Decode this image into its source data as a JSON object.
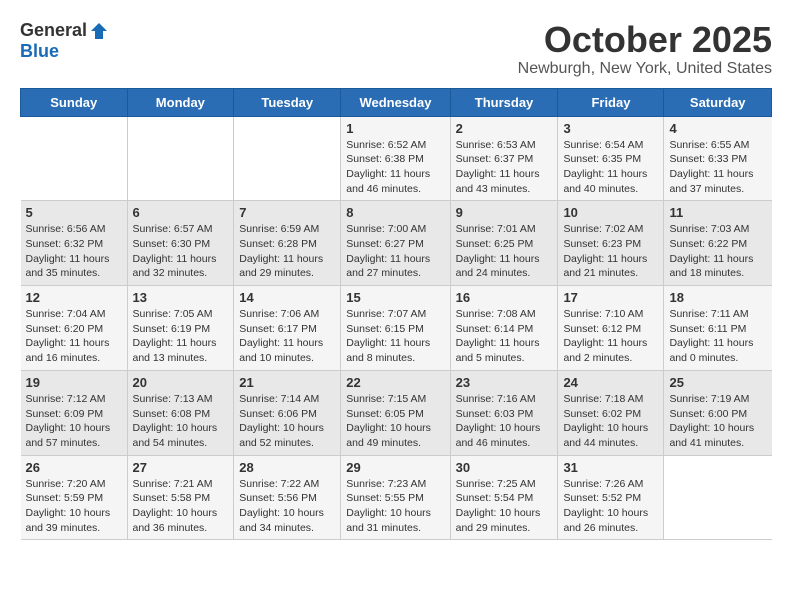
{
  "header": {
    "logo_general": "General",
    "logo_blue": "Blue",
    "month_title": "October 2025",
    "location": "Newburgh, New York, United States"
  },
  "days_of_week": [
    "Sunday",
    "Monday",
    "Tuesday",
    "Wednesday",
    "Thursday",
    "Friday",
    "Saturday"
  ],
  "weeks": [
    [
      {
        "day": "",
        "info": ""
      },
      {
        "day": "",
        "info": ""
      },
      {
        "day": "",
        "info": ""
      },
      {
        "day": "1",
        "info": "Sunrise: 6:52 AM\nSunset: 6:38 PM\nDaylight: 11 hours\nand 46 minutes."
      },
      {
        "day": "2",
        "info": "Sunrise: 6:53 AM\nSunset: 6:37 PM\nDaylight: 11 hours\nand 43 minutes."
      },
      {
        "day": "3",
        "info": "Sunrise: 6:54 AM\nSunset: 6:35 PM\nDaylight: 11 hours\nand 40 minutes."
      },
      {
        "day": "4",
        "info": "Sunrise: 6:55 AM\nSunset: 6:33 PM\nDaylight: 11 hours\nand 37 minutes."
      }
    ],
    [
      {
        "day": "5",
        "info": "Sunrise: 6:56 AM\nSunset: 6:32 PM\nDaylight: 11 hours\nand 35 minutes."
      },
      {
        "day": "6",
        "info": "Sunrise: 6:57 AM\nSunset: 6:30 PM\nDaylight: 11 hours\nand 32 minutes."
      },
      {
        "day": "7",
        "info": "Sunrise: 6:59 AM\nSunset: 6:28 PM\nDaylight: 11 hours\nand 29 minutes."
      },
      {
        "day": "8",
        "info": "Sunrise: 7:00 AM\nSunset: 6:27 PM\nDaylight: 11 hours\nand 27 minutes."
      },
      {
        "day": "9",
        "info": "Sunrise: 7:01 AM\nSunset: 6:25 PM\nDaylight: 11 hours\nand 24 minutes."
      },
      {
        "day": "10",
        "info": "Sunrise: 7:02 AM\nSunset: 6:23 PM\nDaylight: 11 hours\nand 21 minutes."
      },
      {
        "day": "11",
        "info": "Sunrise: 7:03 AM\nSunset: 6:22 PM\nDaylight: 11 hours\nand 18 minutes."
      }
    ],
    [
      {
        "day": "12",
        "info": "Sunrise: 7:04 AM\nSunset: 6:20 PM\nDaylight: 11 hours\nand 16 minutes."
      },
      {
        "day": "13",
        "info": "Sunrise: 7:05 AM\nSunset: 6:19 PM\nDaylight: 11 hours\nand 13 minutes."
      },
      {
        "day": "14",
        "info": "Sunrise: 7:06 AM\nSunset: 6:17 PM\nDaylight: 11 hours\nand 10 minutes."
      },
      {
        "day": "15",
        "info": "Sunrise: 7:07 AM\nSunset: 6:15 PM\nDaylight: 11 hours\nand 8 minutes."
      },
      {
        "day": "16",
        "info": "Sunrise: 7:08 AM\nSunset: 6:14 PM\nDaylight: 11 hours\nand 5 minutes."
      },
      {
        "day": "17",
        "info": "Sunrise: 7:10 AM\nSunset: 6:12 PM\nDaylight: 11 hours\nand 2 minutes."
      },
      {
        "day": "18",
        "info": "Sunrise: 7:11 AM\nSunset: 6:11 PM\nDaylight: 11 hours\nand 0 minutes."
      }
    ],
    [
      {
        "day": "19",
        "info": "Sunrise: 7:12 AM\nSunset: 6:09 PM\nDaylight: 10 hours\nand 57 minutes."
      },
      {
        "day": "20",
        "info": "Sunrise: 7:13 AM\nSunset: 6:08 PM\nDaylight: 10 hours\nand 54 minutes."
      },
      {
        "day": "21",
        "info": "Sunrise: 7:14 AM\nSunset: 6:06 PM\nDaylight: 10 hours\nand 52 minutes."
      },
      {
        "day": "22",
        "info": "Sunrise: 7:15 AM\nSunset: 6:05 PM\nDaylight: 10 hours\nand 49 minutes."
      },
      {
        "day": "23",
        "info": "Sunrise: 7:16 AM\nSunset: 6:03 PM\nDaylight: 10 hours\nand 46 minutes."
      },
      {
        "day": "24",
        "info": "Sunrise: 7:18 AM\nSunset: 6:02 PM\nDaylight: 10 hours\nand 44 minutes."
      },
      {
        "day": "25",
        "info": "Sunrise: 7:19 AM\nSunset: 6:00 PM\nDaylight: 10 hours\nand 41 minutes."
      }
    ],
    [
      {
        "day": "26",
        "info": "Sunrise: 7:20 AM\nSunset: 5:59 PM\nDaylight: 10 hours\nand 39 minutes."
      },
      {
        "day": "27",
        "info": "Sunrise: 7:21 AM\nSunset: 5:58 PM\nDaylight: 10 hours\nand 36 minutes."
      },
      {
        "day": "28",
        "info": "Sunrise: 7:22 AM\nSunset: 5:56 PM\nDaylight: 10 hours\nand 34 minutes."
      },
      {
        "day": "29",
        "info": "Sunrise: 7:23 AM\nSunset: 5:55 PM\nDaylight: 10 hours\nand 31 minutes."
      },
      {
        "day": "30",
        "info": "Sunrise: 7:25 AM\nSunset: 5:54 PM\nDaylight: 10 hours\nand 29 minutes."
      },
      {
        "day": "31",
        "info": "Sunrise: 7:26 AM\nSunset: 5:52 PM\nDaylight: 10 hours\nand 26 minutes."
      },
      {
        "day": "",
        "info": ""
      }
    ]
  ]
}
